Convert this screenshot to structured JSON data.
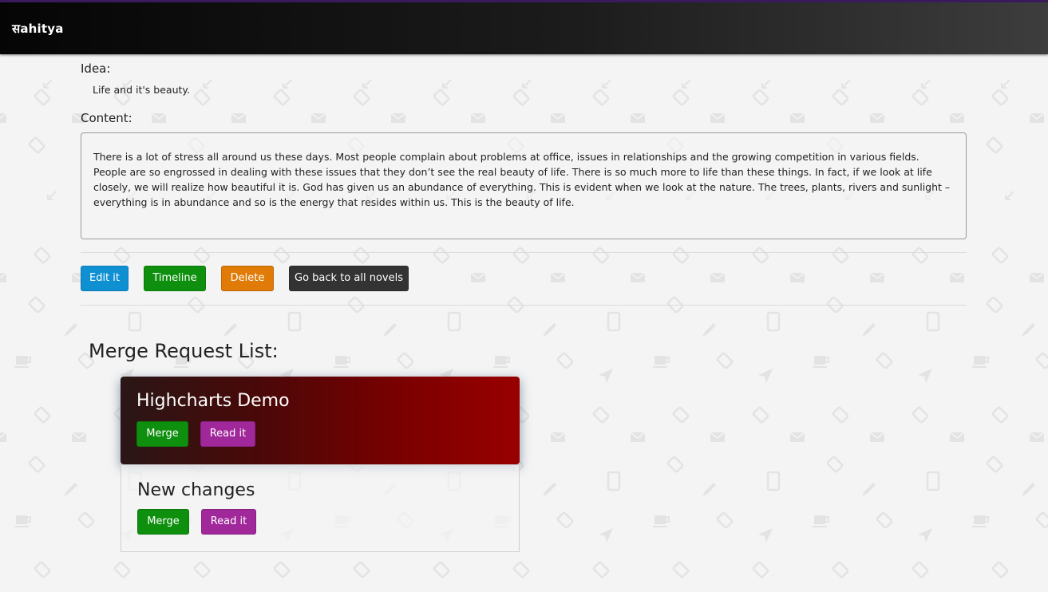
{
  "navbar": {
    "brand": "सahitya"
  },
  "novel": {
    "idea_label": "Idea:",
    "idea": "Life and it's beauty.",
    "content_label": "Content:",
    "content": "There is a lot of stress all around us these days. Most people complain about problems at office, issues in relationships and the growing competition in various fields. People are so engrossed in dealing with these issues that they don’t see the real beauty of life. There is so much more to life than these things. In fact, if we look at life closely, we will realize how beautiful it is. God has given us an abundance of everything. This is evident when we look at the nature. The trees, plants, rivers and sunlight – everything is in abundance and so is the energy that resides within us. This is the beauty of life."
  },
  "actions": {
    "edit": "Edit it",
    "timeline": "Timeline",
    "delete": "Delete",
    "back": "Go back to all novels"
  },
  "merge_requests": {
    "title": "Merge Request List:",
    "items": [
      {
        "title": "Highcharts Demo",
        "merge_label": "Merge",
        "read_label": "Read it",
        "active": true
      },
      {
        "title": "New changes",
        "merge_label": "Merge",
        "read_label": "Read it",
        "active": false
      }
    ]
  },
  "colors": {
    "primary": "#0e90d2",
    "success": "#0e8f0e",
    "warning": "#e07b07",
    "dark": "#333333",
    "purple": "#a0289a",
    "active_card": "#990000"
  }
}
